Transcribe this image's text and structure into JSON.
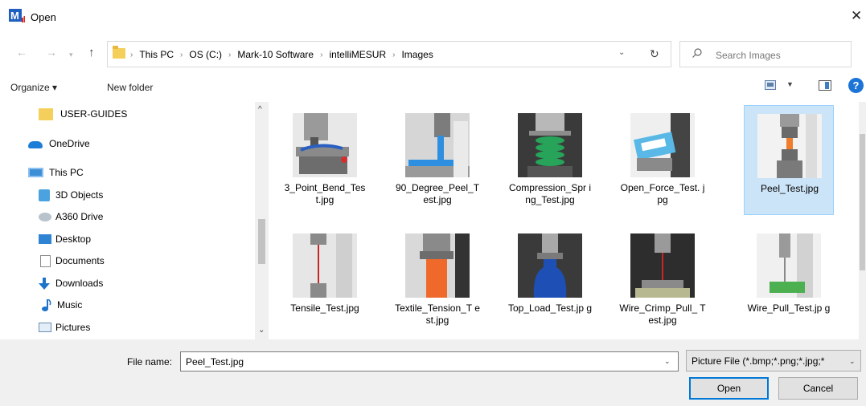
{
  "window": {
    "title": "Open",
    "app_icon": "M",
    "close_glyph": "✕"
  },
  "address": {
    "crumbs": [
      "This PC",
      "OS (C:)",
      "Mark-10 Software",
      "intelliMESUR",
      "Images"
    ],
    "search_placeholder": "Search Images"
  },
  "toolbar": {
    "organize_label": "Organize ▾",
    "new_folder_label": "New folder",
    "help_label": "?"
  },
  "nav_pane": {
    "items": [
      {
        "label": "USER-GUIDES",
        "icon": "folder-icon"
      },
      {
        "label": "OneDrive",
        "icon": "cloud-icon"
      },
      {
        "label": "This PC",
        "icon": "computer-icon"
      },
      {
        "label": "3D Objects",
        "icon": "3d-objects-icon"
      },
      {
        "label": "A360 Drive",
        "icon": "drive-icon"
      },
      {
        "label": "Desktop",
        "icon": "desktop-icon"
      },
      {
        "label": "Documents",
        "icon": "documents-icon"
      },
      {
        "label": "Downloads",
        "icon": "download-arrow-icon"
      },
      {
        "label": "Music",
        "icon": "music-note-icon"
      },
      {
        "label": "Pictures",
        "icon": "pictures-icon"
      }
    ]
  },
  "files": [
    {
      "name": "3_Point_Bend_Tes t.jpg",
      "selected": false
    },
    {
      "name": "90_Degree_Peel_T est.jpg",
      "selected": false
    },
    {
      "name": "Compression_Spr ing_Test.jpg",
      "selected": false
    },
    {
      "name": "Open_Force_Test. jpg",
      "selected": false
    },
    {
      "name": "Peel_Test.jpg",
      "selected": true
    },
    {
      "name": "Tensile_Test.jpg",
      "selected": false
    },
    {
      "name": "Textile_Tension_T est.jpg",
      "selected": false
    },
    {
      "name": "Top_Load_Test.jp g",
      "selected": false
    },
    {
      "name": "Wire_Crimp_Pull_ Test.jpg",
      "selected": false
    },
    {
      "name": "Wire_Pull_Test.jp g",
      "selected": false
    }
  ],
  "bottom": {
    "file_name_label": "File name:",
    "file_name_value": "Peel_Test.jpg",
    "filter_value": "Picture File (*.bmp;*.png;*.jpg;*",
    "open_label": "Open",
    "cancel_label": "Cancel"
  },
  "colors": {
    "selection_bg": "#cce4f7",
    "selection_border": "#99d1ff",
    "accent": "#0078d7"
  }
}
